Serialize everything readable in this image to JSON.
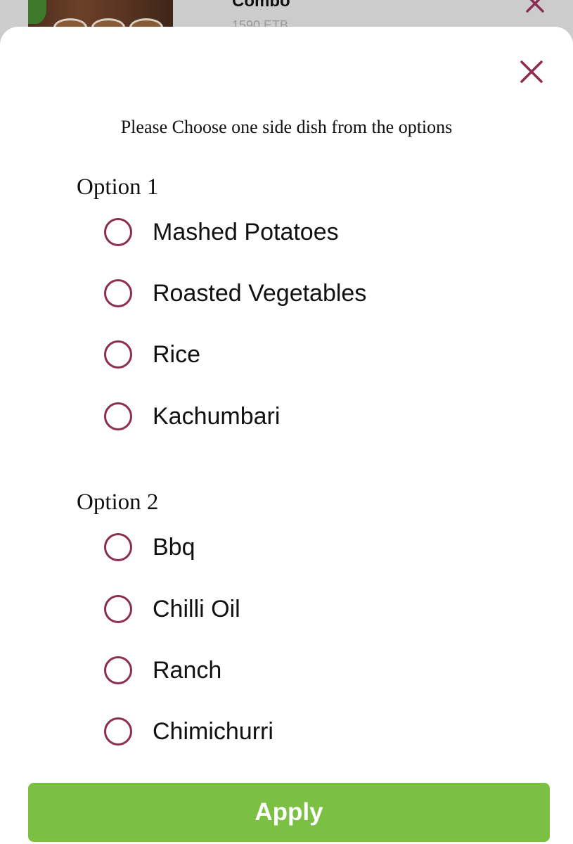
{
  "background_item": {
    "title": "Combo",
    "price": "1590 ETB"
  },
  "modal": {
    "close_icon": "close-icon",
    "instruction": "Please Choose one side dish from the options",
    "accent_color": "#8b2e52",
    "groups": [
      {
        "title": "Option 1",
        "options": [
          "Mashed Potatoes",
          "Roasted Vegetables",
          "Rice",
          "Kachumbari"
        ]
      },
      {
        "title": "Option 2",
        "options": [
          "Bbq",
          "Chilli Oil",
          "Ranch",
          "Chimichurri"
        ]
      }
    ],
    "apply_label": "Apply",
    "apply_color": "#7bc043"
  }
}
